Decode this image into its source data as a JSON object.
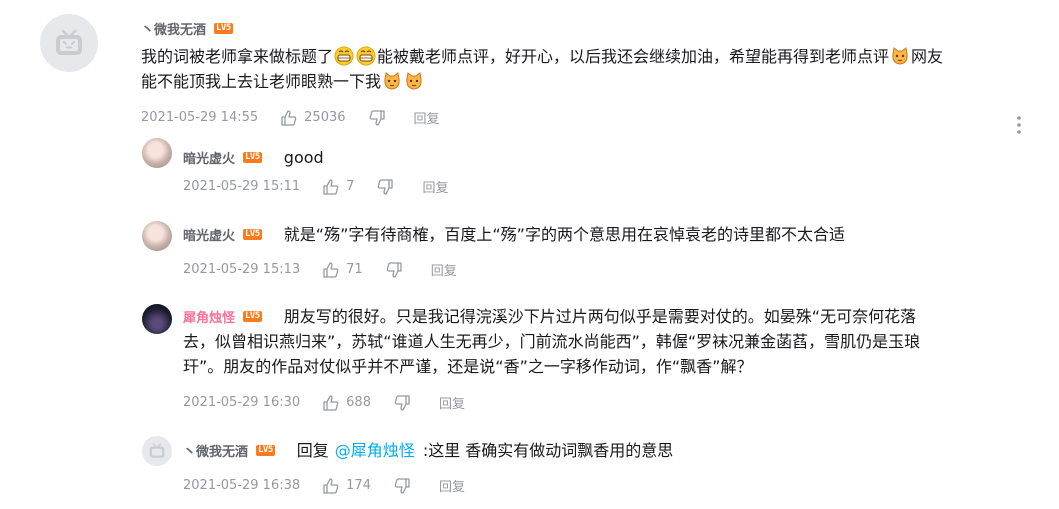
{
  "main_comment": {
    "username": "丶微我无酒",
    "level": "LV5",
    "text_part1": "我的词被老师拿来做标题了",
    "text_part2": "能被戴老师点评，好开心，以后我还会继续加油，希望能再得到老师点评",
    "text_part3": "网友",
    "text_line2": "能不能顶我上去让老师眼熟一下我",
    "time": "2021-05-29 14:55",
    "likes": "25036",
    "reply_label": "回复"
  },
  "replies": [
    {
      "username": "暗光虚火",
      "level": "LV5",
      "text": "good",
      "time": "2021-05-29 15:11",
      "likes": "7",
      "reply_label": "回复"
    },
    {
      "username": "暗光虚火",
      "level": "LV5",
      "text": "就是“殇”字有待商榷，百度上“殇”字的两个意思用在哀悼袁老的诗里都不太合适",
      "time": "2021-05-29 15:13",
      "likes": "71",
      "reply_label": "回复"
    },
    {
      "username": "犀角烛怪",
      "level": "LV5",
      "text_line1": "朋友写的很好。只是我记得浣溪沙下片过片两句似乎是需要对仗的。如晏殊“无可奈何花落",
      "text_line2": "去，似曾相识燕归来”，苏轼“谁道人生无再少，门前流水尚能西”，韩偓“罗袜况兼金菡萏，雪肌仍是玉琅",
      "text_line3": "玕”。朋友的作品对仗似乎并不严谨，还是说“香”之一字移作动词，作“飘香”解？",
      "time": "2021-05-29 16:30",
      "likes": "688",
      "reply_label": "回复"
    },
    {
      "username": "丶微我无酒",
      "level": "LV5",
      "reply_prefix": "回复",
      "mention": "@犀角烛怪",
      "text": ":这里 香确实有做动词飘香用的意思",
      "time": "2021-05-29 16:38",
      "likes": "174",
      "reply_label": "回复"
    }
  ],
  "colors": {
    "username_pink": "#fb7299",
    "mention_blue": "#00aeec",
    "meta_gray": "#9499a0",
    "level_orange": "#ff7a1a"
  },
  "icons": [
    "tv-avatar-icon",
    "thumb-up-icon",
    "thumb-down-icon",
    "grin-emoji-icon",
    "cat-emoji-icon",
    "more-dots-icon"
  ]
}
